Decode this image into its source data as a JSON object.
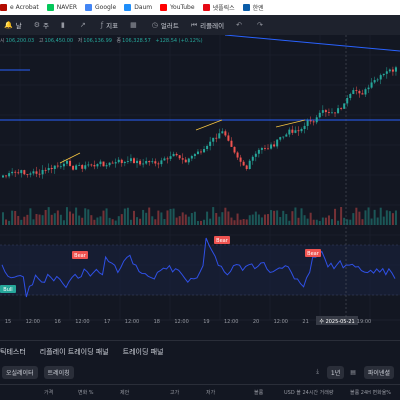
{
  "bookmarks": [
    {
      "label": "e Acrobat",
      "color": "#b30b00"
    },
    {
      "label": "NAVER",
      "color": "#03c75a"
    },
    {
      "label": "Google",
      "color": "#4285f4"
    },
    {
      "label": "Daum",
      "color": "#1e8efa"
    },
    {
      "label": "YouTube",
      "color": "#ff0000"
    },
    {
      "label": "넷플릭스",
      "color": "#e50914"
    },
    {
      "label": "한엔",
      "color": "#0a5ca8"
    }
  ],
  "toolbar": {
    "items": [
      {
        "icon": "bell-icon",
        "glyph": "🔔",
        "label": "날"
      },
      {
        "icon": "speed-icon",
        "glyph": "⚙",
        "label": "주"
      },
      {
        "icon": "candle-icon",
        "glyph": "▮",
        "label": ""
      },
      {
        "icon": "chart-icon",
        "glyph": "↗",
        "label": ""
      },
      {
        "icon": "indicator-icon",
        "glyph": "ƒ",
        "label": "지표"
      },
      {
        "icon": "layout-icon",
        "glyph": "▦",
        "label": ""
      },
      {
        "icon": "alert-icon",
        "glyph": "◷",
        "label": "얼러트"
      },
      {
        "icon": "replay-icon",
        "glyph": "⏮",
        "label": "리플레이"
      },
      {
        "icon": "undo-icon",
        "glyph": "↶",
        "label": ""
      },
      {
        "icon": "redo-icon",
        "glyph": "↷",
        "label": ""
      }
    ]
  },
  "ohlc": {
    "prefix": "시",
    "open": "106,200.03",
    "high_label": "고",
    "high": "106,450.00",
    "low_label": "저",
    "low": "106,136.99",
    "close_label": "종",
    "close": "106,328.57",
    "change": "+128.54 (+0.12%)"
  },
  "signals": {
    "bear": "Bear",
    "bull": "Bull"
  },
  "x_axis": {
    "labels": [
      "15",
      "12:00",
      "16",
      "12:00",
      "17",
      "12:00",
      "18",
      "12:00",
      "19",
      "12:00",
      "20",
      "12:00",
      "21"
    ],
    "current": "수 2025-05-21",
    "current_time": "19:00"
  },
  "colors": {
    "up": "#26a69a",
    "down": "#ef5350",
    "blue": "#2962ff",
    "bg": "#131722",
    "rsi": "#2f50e6"
  },
  "bottom_tabs": [
    "틱테스터",
    "리플레이 트레이딩 패널",
    "트레이딩 패널"
  ],
  "filters": {
    "left1": "오실레이터",
    "left2": "트레이칭",
    "right": "1년",
    "right2": "파이넨셜"
  },
  "table_headers": [
    "가격",
    "변화 %",
    "제안",
    "고가",
    "저가",
    "볼륨",
    "USD 볼 24시간 거래량",
    "볼륨 24H 변화율%"
  ]
}
